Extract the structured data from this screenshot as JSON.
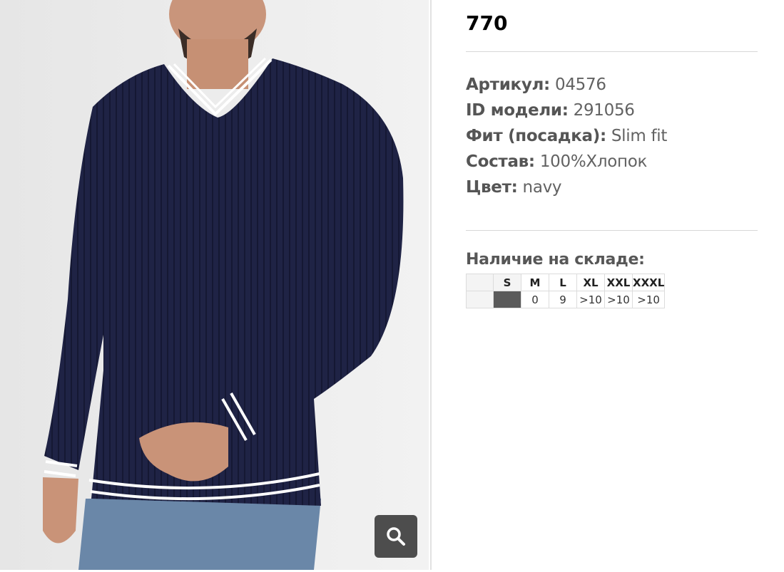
{
  "photo": {
    "alt_name": "product-photo-navy-sweater",
    "zoom_icon": "search-icon"
  },
  "product": {
    "title": "770"
  },
  "specs": [
    {
      "key": "Артикул:",
      "value": "04576"
    },
    {
      "key": "ID модели:",
      "value": "291056"
    },
    {
      "key": "Фит (посадка):",
      "value": "Slim fit"
    },
    {
      "key": "Состав:",
      "value": "100%Хлопок"
    },
    {
      "key": "Цвет:",
      "value": "navy"
    }
  ],
  "stock": {
    "title": "Наличие на складе:",
    "sizes": [
      "S",
      "M",
      "L",
      "XL",
      "XXL",
      "XXXL"
    ],
    "quantities": [
      "",
      "0",
      "9",
      ">10",
      ">10",
      ">10"
    ],
    "unavailable_color": "#5a5a5a"
  },
  "colors": {
    "sweater": "#1f2345",
    "stripe": "#ffffff",
    "zoom_bg": "#4d4d4d"
  }
}
